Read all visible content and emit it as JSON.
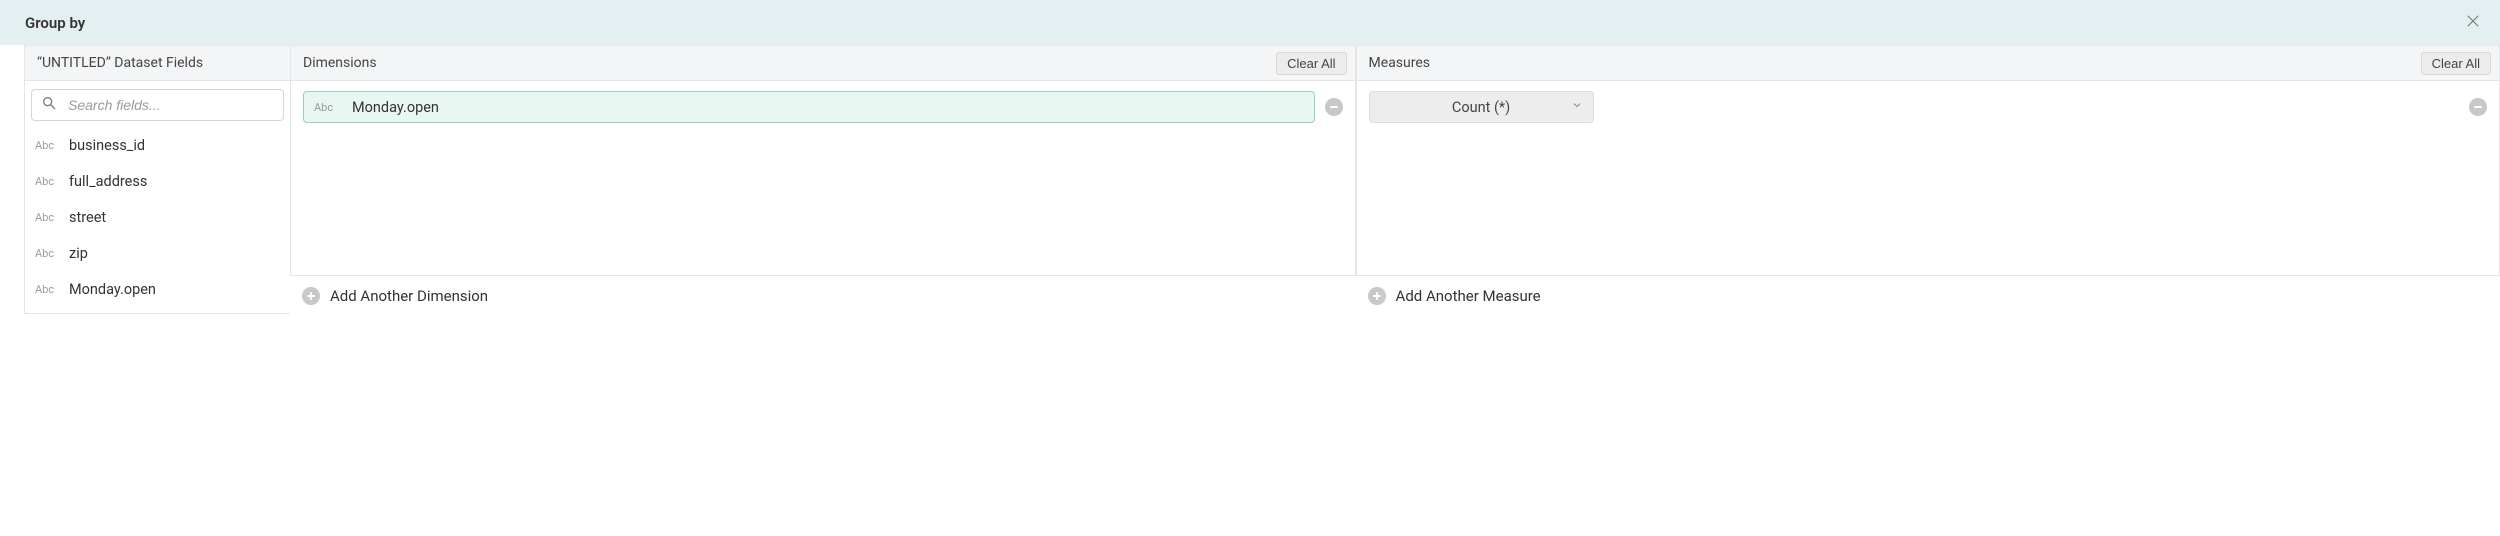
{
  "header": {
    "title": "Group by"
  },
  "fields_panel": {
    "title": "“UNTITLED” Dataset Fields",
    "search_placeholder": "Search fields...",
    "items": [
      {
        "type": "Abc",
        "label": "business_id"
      },
      {
        "type": "Abc",
        "label": "full_address"
      },
      {
        "type": "Abc",
        "label": "street"
      },
      {
        "type": "Abc",
        "label": "zip"
      },
      {
        "type": "Abc",
        "label": "Monday.open"
      }
    ]
  },
  "dimensions_panel": {
    "title": "Dimensions",
    "clear_label": "Clear All",
    "items": [
      {
        "type": "Abc",
        "label": "Monday.open"
      }
    ],
    "add_label": "Add Another Dimension"
  },
  "measures_panel": {
    "title": "Measures",
    "clear_label": "Clear All",
    "items": [
      {
        "label": "Count (*)"
      }
    ],
    "add_label": "Add Another Measure"
  }
}
